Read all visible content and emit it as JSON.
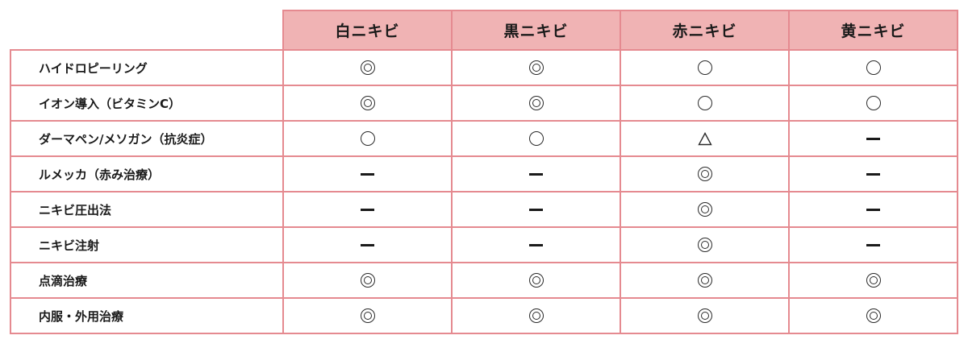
{
  "columns": [
    "白ニキビ",
    "黒ニキビ",
    "赤ニキビ",
    "黄ニキビ"
  ],
  "rows": [
    {
      "label": "ハイドロピーリング",
      "marks": [
        "◎",
        "◎",
        "○",
        "○"
      ]
    },
    {
      "label": "イオン導入（ビタミンC）",
      "marks": [
        "◎",
        "◎",
        "○",
        "○"
      ]
    },
    {
      "label": "ダーマペン/メソガン（抗炎症）",
      "marks": [
        "○",
        "○",
        "△",
        "ー"
      ]
    },
    {
      "label": "ルメッカ（赤み治療）",
      "marks": [
        "ー",
        "ー",
        "◎",
        "ー"
      ]
    },
    {
      "label": "ニキビ圧出法",
      "marks": [
        "ー",
        "ー",
        "◎",
        "ー"
      ]
    },
    {
      "label": "ニキビ注射",
      "marks": [
        "ー",
        "ー",
        "◎",
        "ー"
      ]
    },
    {
      "label": "点滴治療",
      "marks": [
        "◎",
        "◎",
        "◎",
        "◎"
      ]
    },
    {
      "label": "内服・外用治療",
      "marks": [
        "◎",
        "◎",
        "◎",
        "◎"
      ]
    }
  ],
  "colors": {
    "header_bg": "#f0b3b4",
    "border": "#e58a90"
  }
}
